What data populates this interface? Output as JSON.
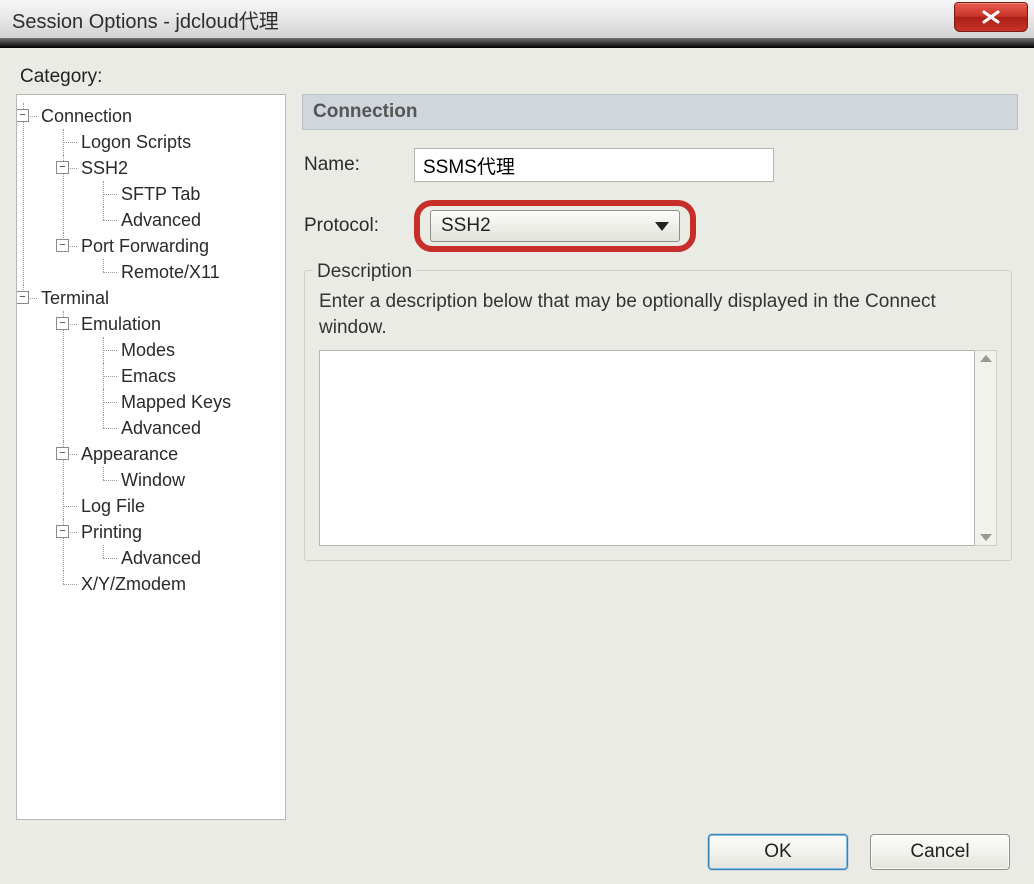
{
  "window": {
    "title": "Session Options - jdcloud代理"
  },
  "category_label": "Category:",
  "tree": {
    "connection": "Connection",
    "logon_scripts": "Logon Scripts",
    "ssh2": "SSH2",
    "sftp_tab": "SFTP Tab",
    "ssh2_advanced": "Advanced",
    "port_forwarding": "Port Forwarding",
    "remote_x11": "Remote/X11",
    "terminal": "Terminal",
    "emulation": "Emulation",
    "modes": "Modes",
    "emacs": "Emacs",
    "mapped_keys": "Mapped Keys",
    "emul_advanced": "Advanced",
    "appearance": "Appearance",
    "window": "Window",
    "log_file": "Log File",
    "printing": "Printing",
    "print_advanced": "Advanced",
    "xyzmodem": "X/Y/Zmodem"
  },
  "panel": {
    "header": "Connection",
    "name_label": "Name:",
    "name_value": "SSMS代理",
    "protocol_label": "Protocol:",
    "protocol_value": "SSH2",
    "description_title": "Description",
    "description_help": "Enter a description below that may be optionally displayed in the Connect window.",
    "description_value": ""
  },
  "buttons": {
    "ok": "OK",
    "cancel": "Cancel"
  }
}
